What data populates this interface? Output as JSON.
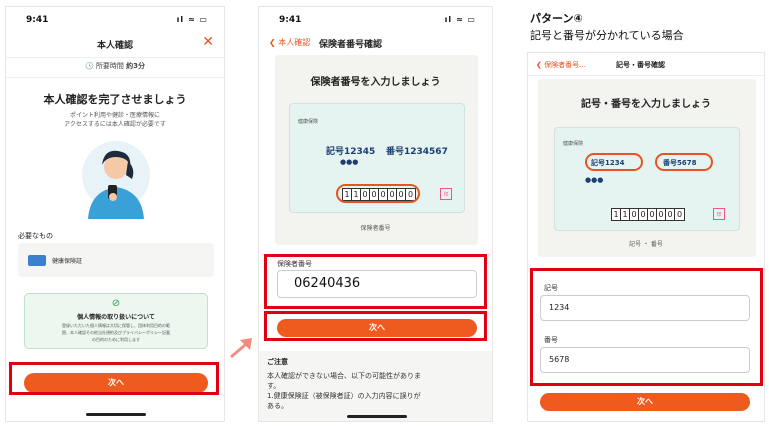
{
  "accent": "#ef5a1f",
  "highlight": "#e00012",
  "screen1": {
    "time": "9:41",
    "signal": "ıl ≈ ▭",
    "title": "本人確認",
    "close": "✕",
    "duration_label": "所要時間",
    "duration_value": "約3分",
    "heading": "本人確認を完了させましょう",
    "subtext_line1": "ポイント利用や健診・医療情報に",
    "subtext_line2": "アクセスするには本人確認が必要です",
    "required_label": "必要なもの",
    "required_item": "健康保険証",
    "privacy_title": "個人情報の取り扱いについて",
    "privacy_body_line1": "登録いただいた個人情報は大切に保管し、団体利用目的の範",
    "privacy_body_line2": "囲、本人確認その他当社規約及びプライバシーポリシー記載",
    "privacy_body_line3": "の目的のために利用します",
    "next_button": "次へ"
  },
  "screen2": {
    "time": "9:41",
    "signal": "ıl ≈ ▭",
    "back_label": "本人確認",
    "title": "保険者番号確認",
    "heading": "保険者番号を入力しましょう",
    "card_num_left": "記号12345",
    "card_num_right": "番号1234567",
    "card_dots": "●●●",
    "card_digits": [
      "1",
      "1",
      "0",
      "0",
      "0",
      "0",
      "0",
      "0"
    ],
    "card_caption": "保険者番号",
    "field_label": "保険者番号",
    "field_value": "06240436",
    "next_button": "次へ",
    "notice_title": "ご注意",
    "notice_line1": "本人確認ができない場合、以下の可能性がありま",
    "notice_line2": "す。",
    "notice_line3": "1.健康保険証（被保険者証）の入力内容に誤りが",
    "notice_line4": "ある。"
  },
  "pattern": {
    "title": "パターン④",
    "subtitle": "記号と番号が分かれている場合"
  },
  "screen3": {
    "back_label": "保険者番号…",
    "title": "記号・番号確認",
    "heading": "記号・番号を入力しましょう",
    "card_num_left": "記号1234",
    "card_num_right": "番号5678",
    "card_dots": "●●●",
    "card_digits": [
      "1",
      "1",
      "0",
      "0",
      "0",
      "0",
      "0",
      "0"
    ],
    "card_caption": "記号 ・ 番号",
    "field1_label": "記号",
    "field1_value": "1234",
    "field2_label": "番号",
    "field2_value": "5678",
    "next_button": "次へ"
  }
}
